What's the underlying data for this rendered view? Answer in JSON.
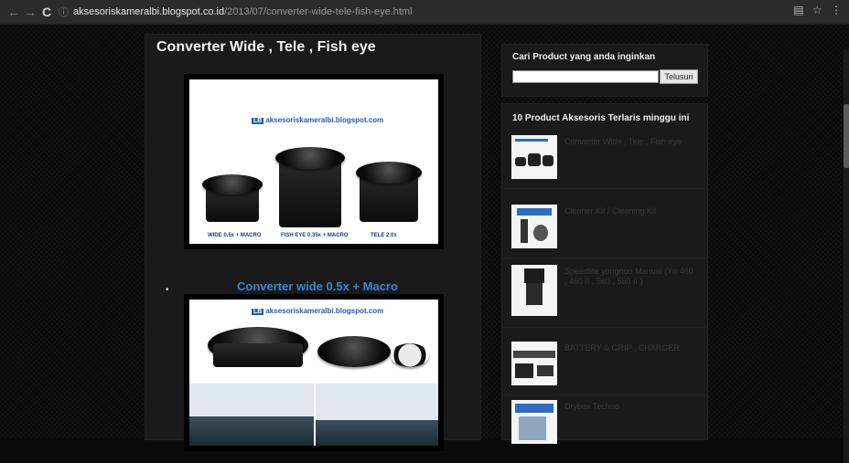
{
  "browser": {
    "url_host": "aksesoriskameralbi.blogspot.co.id",
    "url_path": "/2013/07/converter-wide-tele-fish-eye.html"
  },
  "post": {
    "title": "Converter Wide , Tele , Fish eye",
    "watermark": "aksesoriskameralbi.blogspot.com",
    "watermark_badge": "LB",
    "image1_captions": [
      "WIDE 0.5x + MACRO",
      "FISH EYE 0.35x + MACRO",
      "TELE 2.0x"
    ],
    "subheading": "Converter wide 0.5x + Macro",
    "bullet": "•"
  },
  "sidebar": {
    "search": {
      "title": "Cari Product yang anda inginkan",
      "input_value": "",
      "button_label": "Telusuri"
    },
    "top_products": {
      "title": "10 Product Aksesoris Terlaris minggu ini",
      "items": [
        {
          "label": "Converter Wide , Tele , Fish eye"
        },
        {
          "label": "Cleaner Kit / Cleaning Kit"
        },
        {
          "label": "Speedlite yongnuo Manual (Yn 460 , 460 II , 560 , 560 II )"
        },
        {
          "label": "BATTERY & GRIP , CHARGER"
        },
        {
          "label": "Drybox Techno"
        }
      ]
    }
  },
  "colors": {
    "accent_link": "#3a86d6",
    "muted_text": "#3a3a3a"
  }
}
